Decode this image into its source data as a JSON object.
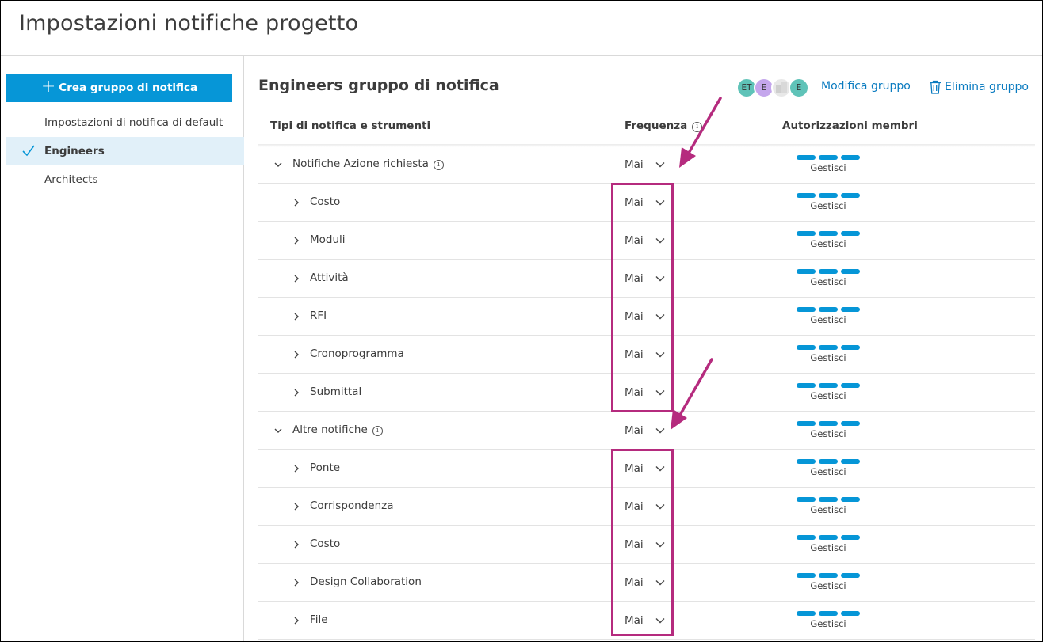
{
  "page": {
    "title": "Impostazioni notifiche progetto"
  },
  "sidebar": {
    "create_button": "Crea gruppo di notifica",
    "items": [
      {
        "label": "Impostazioni di notifica di default",
        "active": false
      },
      {
        "label": "Engineers",
        "active": true
      },
      {
        "label": "Architects",
        "active": false
      }
    ]
  },
  "group": {
    "title": "Engineers gruppo di notifica",
    "avatars": [
      {
        "initials": "ET",
        "color": "#5fc3b8"
      },
      {
        "initials": "E",
        "color": "#c4a6ec"
      },
      {
        "initials": "",
        "color": "#e8e8e8"
      },
      {
        "initials": "E",
        "color": "#5fc3b8"
      }
    ],
    "edit_label": "Modifica gruppo",
    "delete_label": "Elimina gruppo"
  },
  "table": {
    "headers": {
      "types": "Tipi di notifica e strumenti",
      "frequency": "Frequenza",
      "permissions": "Autorizzazioni membri"
    },
    "rows": [
      {
        "label": "Notifiche Azione richiesta",
        "level": 0,
        "expanded": true,
        "info": true,
        "frequency": "Mai",
        "permission": "Gestisci"
      },
      {
        "label": "Costo",
        "level": 1,
        "expanded": false,
        "info": false,
        "frequency": "Mai",
        "permission": "Gestisci"
      },
      {
        "label": "Moduli",
        "level": 1,
        "expanded": false,
        "info": false,
        "frequency": "Mai",
        "permission": "Gestisci"
      },
      {
        "label": "Attività",
        "level": 1,
        "expanded": false,
        "info": false,
        "frequency": "Mai",
        "permission": "Gestisci"
      },
      {
        "label": "RFI",
        "level": 1,
        "expanded": false,
        "info": false,
        "frequency": "Mai",
        "permission": "Gestisci"
      },
      {
        "label": "Cronoprogramma",
        "level": 1,
        "expanded": false,
        "info": false,
        "frequency": "Mai",
        "permission": "Gestisci"
      },
      {
        "label": "Submittal",
        "level": 1,
        "expanded": false,
        "info": false,
        "frequency": "Mai",
        "permission": "Gestisci"
      },
      {
        "label": "Altre notifiche",
        "level": 0,
        "expanded": true,
        "info": true,
        "frequency": "Mai",
        "permission": "Gestisci"
      },
      {
        "label": "Ponte",
        "level": 1,
        "expanded": false,
        "info": false,
        "frequency": "Mai",
        "permission": "Gestisci"
      },
      {
        "label": "Corrispondenza",
        "level": 1,
        "expanded": false,
        "info": false,
        "frequency": "Mai",
        "permission": "Gestisci"
      },
      {
        "label": "Costo",
        "level": 1,
        "expanded": false,
        "info": false,
        "frequency": "Mai",
        "permission": "Gestisci"
      },
      {
        "label": "Design Collaboration",
        "level": 1,
        "expanded": false,
        "info": false,
        "frequency": "Mai",
        "permission": "Gestisci"
      },
      {
        "label": "File",
        "level": 1,
        "expanded": false,
        "info": false,
        "frequency": "Mai",
        "permission": "Gestisci"
      }
    ]
  },
  "colors": {
    "accent": "#0696d7",
    "link": "#0a7bc0",
    "annotation": "#b52b7e",
    "active_bg": "#e1f0f9"
  }
}
